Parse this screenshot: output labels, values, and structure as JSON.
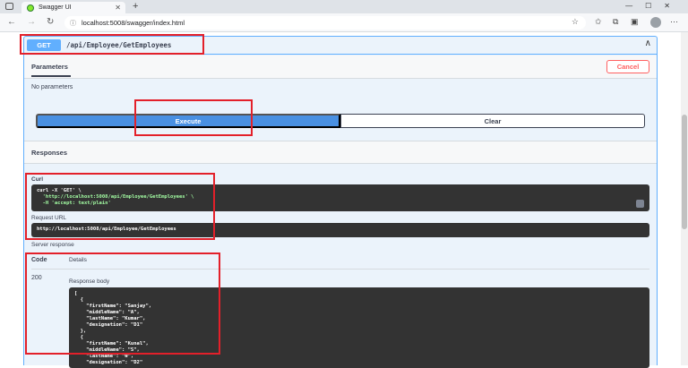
{
  "browser": {
    "tab_title": "Swagger UI",
    "tab_close": "✕",
    "new_tab": "+",
    "window_controls": "—☐✕",
    "back": "←",
    "forward": "→",
    "reload": "↻",
    "url": "localhost:5008/swagger/index.html",
    "lock": "ⓘ",
    "favorite": "☆",
    "icons": [
      "star-icon",
      "collections-icon",
      "extensions-icon",
      "more-icon"
    ]
  },
  "operation": {
    "method": "GET",
    "path": "/api/Employee/GetEmployees",
    "collapse_icon": "∧"
  },
  "parameters": {
    "title": "Parameters",
    "cancel_label": "Cancel",
    "empty_text": "No parameters"
  },
  "actions": {
    "execute_label": "Execute",
    "clear_label": "Clear"
  },
  "responses": {
    "title": "Responses",
    "curl_label": "Curl",
    "curl_lines": [
      "curl -X 'GET' \\",
      "  'http://localhost:5008/api/Employee/GetEmployees' \\",
      "  -H 'accept: text/plain'"
    ],
    "request_url_label": "Request URL",
    "request_url": "http://localhost:5008/api/Employee/GetEmployees",
    "server_response_label": "Server response",
    "code_header": "Code",
    "details_header": "Details",
    "status_code": "200",
    "response_body_label": "Response body",
    "response_body": "[\n  {\n    \"firstName\": \"Sanjay\",\n    \"middleName\": \"A\",\n    \"lastName\": \"Kumar\",\n    \"designation\": \"D1\"\n  },\n  {\n    \"firstName\": \"Kunal\",\n    \"middleName\": \"S\",\n    \"lastName\": \"W\",\n    \"designation\": \"D2\""
  },
  "colors": {
    "get_blue": "#61affe",
    "execute_blue": "#4990e2",
    "cancel_red": "#ff6060",
    "highlight_red": "#e3202a"
  }
}
